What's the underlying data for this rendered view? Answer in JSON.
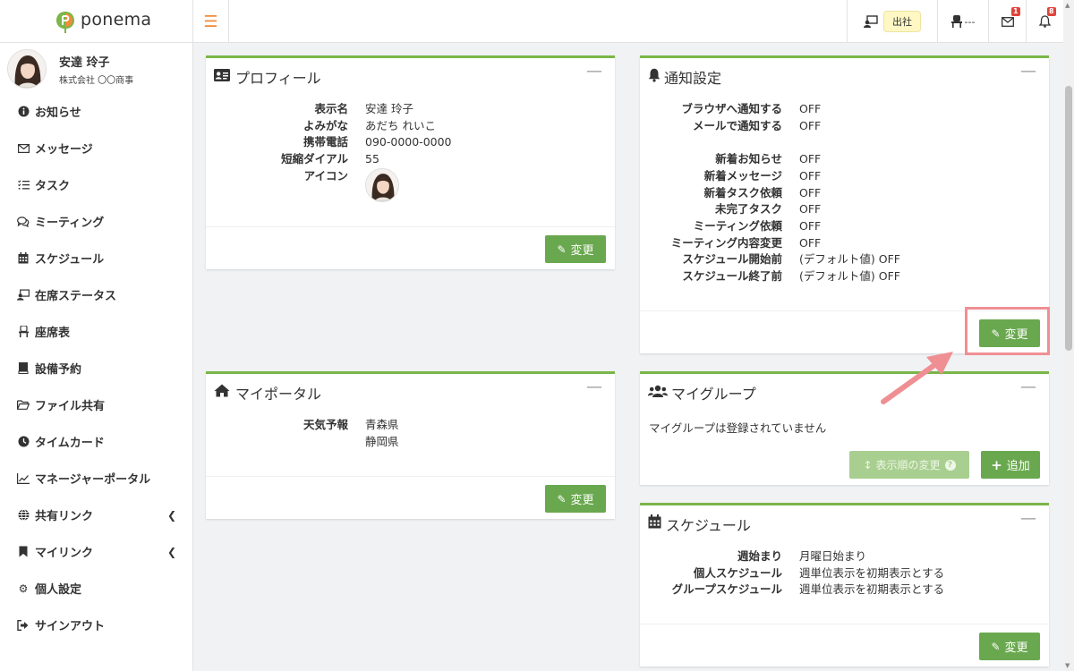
{
  "brand": {
    "name": "ponema"
  },
  "header": {
    "status_label": "出社",
    "seat_label": "---",
    "mail_badge": "1",
    "bell_badge": "8"
  },
  "user": {
    "name": "安達 玲子",
    "company": "株式会社 〇〇商事"
  },
  "nav": [
    {
      "label": "お知らせ",
      "icon": "info-icon"
    },
    {
      "label": "メッセージ",
      "icon": "envelope-icon"
    },
    {
      "label": "タスク",
      "icon": "tasks-icon"
    },
    {
      "label": "ミーティング",
      "icon": "chat-icon"
    },
    {
      "label": "スケジュール",
      "icon": "calendar-icon"
    },
    {
      "label": "在席ステータス",
      "icon": "presence-icon"
    },
    {
      "label": "座席表",
      "icon": "chair-icon"
    },
    {
      "label": "設備予約",
      "icon": "book-icon"
    },
    {
      "label": "ファイル共有",
      "icon": "folder-icon"
    },
    {
      "label": "タイムカード",
      "icon": "clock-icon"
    },
    {
      "label": "マネージャーポータル",
      "icon": "chart-icon"
    },
    {
      "label": "共有リンク",
      "icon": "globe-icon"
    },
    {
      "label": "マイリンク",
      "icon": "bookmark-icon"
    },
    {
      "label": "個人設定",
      "icon": "gear-icon"
    },
    {
      "label": "サインアウト",
      "icon": "signout-icon"
    }
  ],
  "profile": {
    "title": "プロフィール",
    "rows": [
      {
        "k": "表示名",
        "v": "安達 玲子"
      },
      {
        "k": "よみがな",
        "v": "あだち れいこ"
      },
      {
        "k": "携帯電話",
        "v": "090-0000-0000"
      },
      {
        "k": "短縮ダイアル",
        "v": "55"
      },
      {
        "k": "アイコン",
        "v": ""
      }
    ],
    "button": "変更"
  },
  "notify": {
    "title": "通知設定",
    "rows_a": [
      {
        "k": "ブラウザへ通知する",
        "v": "OFF"
      },
      {
        "k": "メールで通知する",
        "v": "OFF"
      }
    ],
    "rows_b": [
      {
        "k": "新着お知らせ",
        "v": "OFF"
      },
      {
        "k": "新着メッセージ",
        "v": "OFF"
      },
      {
        "k": "新着タスク依頼",
        "v": "OFF"
      },
      {
        "k": "未完了タスク",
        "v": "OFF"
      },
      {
        "k": "ミーティング依頼",
        "v": "OFF"
      },
      {
        "k": "ミーティング内容変更",
        "v": "OFF"
      },
      {
        "k": "スケジュール開始前",
        "v": "(デフォルト値) OFF"
      },
      {
        "k": "スケジュール終了前",
        "v": "(デフォルト値) OFF"
      }
    ],
    "button": "変更"
  },
  "portal": {
    "title": "マイポータル",
    "weather_label": "天気予報",
    "weather_values": [
      "青森県",
      "静岡県"
    ],
    "button": "変更"
  },
  "group": {
    "title": "マイグループ",
    "empty_text": "マイグループは登録されていません",
    "order_button": "表示順の変更",
    "add_button": "追加"
  },
  "schedule": {
    "title": "スケジュール",
    "rows": [
      {
        "k": "週始まり",
        "v": "月曜日始まり"
      },
      {
        "k": "個人スケジュール",
        "v": "週単位表示を初期表示とする"
      },
      {
        "k": "グループスケジュール",
        "v": "週単位表示を初期表示とする"
      }
    ],
    "button": "変更"
  },
  "colors": {
    "accent": "#7ab648",
    "button": "#6aa84f",
    "highlight": "#f08f93",
    "badge": "#e0443a"
  }
}
